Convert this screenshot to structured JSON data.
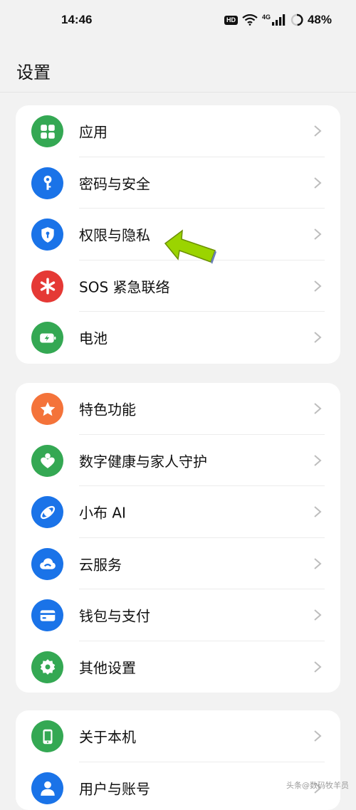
{
  "status_bar": {
    "time": "14:46",
    "hd_badge": "HD",
    "network": "4G",
    "battery": "48%"
  },
  "page": {
    "title": "设置"
  },
  "groups": [
    {
      "items": [
        {
          "label": "应用",
          "icon": "apps-grid-icon",
          "color": "#34a853"
        },
        {
          "label": "密码与安全",
          "icon": "key-icon",
          "color": "#1a73e8"
        },
        {
          "label": "权限与隐私",
          "icon": "shield-lock-icon",
          "color": "#1a73e8"
        },
        {
          "label": "SOS 紧急联络",
          "icon": "asterisk-icon",
          "color": "#e53935"
        },
        {
          "label": "电池",
          "icon": "battery-icon",
          "color": "#34a853"
        }
      ]
    },
    {
      "items": [
        {
          "label": "特色功能",
          "icon": "star-icon",
          "color": "#f4733a"
        },
        {
          "label": "数字健康与家人守护",
          "icon": "person-heart-icon",
          "color": "#34a853"
        },
        {
          "label": "小布 AI",
          "icon": "ai-orbit-icon",
          "color": "#1a73e8"
        },
        {
          "label": "云服务",
          "icon": "cloud-icon",
          "color": "#1a73e8"
        },
        {
          "label": "钱包与支付",
          "icon": "card-icon",
          "color": "#1a73e8"
        },
        {
          "label": "其他设置",
          "icon": "gear-icon",
          "color": "#34a853"
        }
      ]
    },
    {
      "items": [
        {
          "label": "关于本机",
          "icon": "phone-icon",
          "color": "#34a853"
        },
        {
          "label": "用户与账号",
          "icon": "user-icon",
          "color": "#1a73e8"
        }
      ]
    }
  ],
  "annotation": {
    "arrow_color": "#9bd400",
    "arrow_icon": "pointer-arrow-icon"
  },
  "watermark": "头条@数码牧羊员"
}
